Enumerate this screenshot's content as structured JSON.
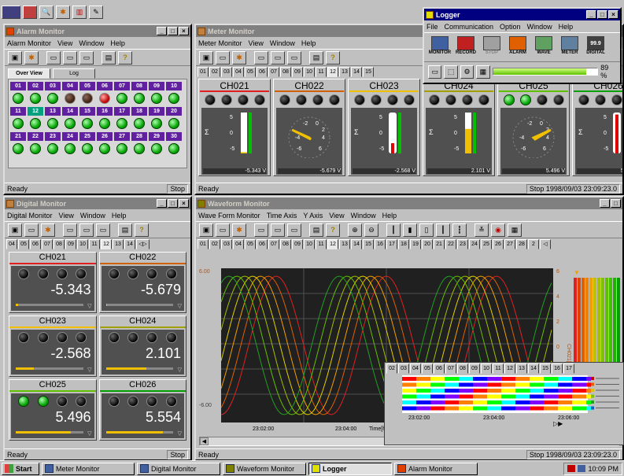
{
  "desktop_toolbar": {
    "icons": [
      "monitor-icon",
      "db-icon",
      "magnify-icon",
      "star-icon",
      "chart-icon",
      "pen-icon"
    ]
  },
  "alarm": {
    "title": "Alarm Monitor",
    "menu": [
      "Alarm Monitor",
      "View",
      "Window",
      "Help"
    ],
    "tabs": [
      "Over View",
      "Log"
    ],
    "rows": [
      {
        "ids": [
          "01",
          "02",
          "03",
          "04",
          "05",
          "06",
          "07",
          "08",
          "09",
          "10"
        ],
        "states": [
          "green",
          "green",
          "green",
          "dark",
          "dark",
          "red",
          "green",
          "green",
          "green",
          "green"
        ],
        "selected": ""
      },
      {
        "ids": [
          "11",
          "12",
          "13",
          "14",
          "15",
          "16",
          "17",
          "18",
          "19",
          "20"
        ],
        "states": [
          "green",
          "green",
          "green",
          "green",
          "green",
          "green",
          "green",
          "green",
          "green",
          "green"
        ],
        "selected": "12"
      },
      {
        "ids": [
          "21",
          "22",
          "23",
          "24",
          "25",
          "26",
          "27",
          "28",
          "29",
          "30"
        ],
        "states": [
          "green",
          "green",
          "green",
          "green",
          "green",
          "green",
          "green",
          "green",
          "green",
          "green"
        ],
        "selected": ""
      }
    ],
    "status_left": "Ready",
    "status_right": "Stop"
  },
  "meter": {
    "title": "Meter Monitor",
    "menu": [
      "Meter Monitor",
      "View",
      "Window",
      "Help"
    ],
    "tabs": [
      "01",
      "02",
      "03",
      "04",
      "05",
      "06",
      "07",
      "08",
      "09",
      "10",
      "11",
      "12",
      "13",
      "14",
      "15"
    ],
    "channels": [
      {
        "name": "CH021",
        "kind": "bar",
        "value": "-5.343 V",
        "level": 0.03,
        "bar_color": "#f0c000",
        "lamps": [
          "off",
          "off",
          "off",
          "off"
        ],
        "line_color": "#e02020"
      },
      {
        "name": "CH022",
        "kind": "gauge",
        "value": "-5.679 V",
        "level": 0.22,
        "lamps": [
          "off",
          "off",
          "off",
          "off"
        ],
        "line_color": "#d06000"
      },
      {
        "name": "CH023",
        "kind": "thermo",
        "value": "-2.568 V",
        "level": 0.25,
        "lamps": [
          "off",
          "off",
          "off",
          "off"
        ],
        "line_color": "#f0c000"
      },
      {
        "name": "CH024",
        "kind": "bar",
        "value": "2.101 V",
        "level": 0.6,
        "bar_color": "#f0c000",
        "lamps": [
          "off",
          "off",
          "off",
          "off"
        ],
        "line_color": "#a0a000"
      },
      {
        "name": "CH025",
        "kind": "gauge",
        "value": "5.496 V",
        "level": 0.78,
        "lamps": [
          "green",
          "green",
          "off",
          "off"
        ],
        "line_color": "#60c000"
      },
      {
        "name": "CH026",
        "kind": "thermo",
        "value": "5.554 V",
        "level": 0.95,
        "lamps": [
          "off",
          "off",
          "off",
          "off"
        ],
        "line_color": "#00a000"
      }
    ],
    "scale": [
      "5",
      "0",
      "-5"
    ],
    "gauge_scale": [
      "-2",
      "0",
      "2",
      "-4",
      "4",
      "-6",
      "6"
    ],
    "status_left": "Ready",
    "status_right": "Stop 1998/09/03 23:09:23.0"
  },
  "logger": {
    "title": "Logger",
    "menu": [
      "File",
      "Communication",
      "Option",
      "Window",
      "Help"
    ],
    "buttons": [
      {
        "label": "MONITOR",
        "icon": "monitor-icon"
      },
      {
        "label": "RECORD",
        "icon": "record-icon"
      },
      {
        "label": "STOP",
        "icon": "stop-icon"
      },
      {
        "label": "ALARM",
        "icon": "alarm-icon"
      },
      {
        "label": "WAVE",
        "icon": "wave-icon"
      },
      {
        "label": "METER",
        "icon": "meter-icon"
      },
      {
        "label": "DIGITAL",
        "icon": "digital-icon",
        "text": "99.9"
      }
    ],
    "progress_pct": "89 %",
    "progress": 0.89
  },
  "digital": {
    "title": "Digital Monitor",
    "menu": [
      "Digital Monitor",
      "View",
      "Window",
      "Help"
    ],
    "tabs": [
      "04",
      "05",
      "06",
      "07",
      "08",
      "09",
      "10",
      "11",
      "12",
      "13",
      "14"
    ],
    "channels": [
      {
        "name": "CH021",
        "value": "-5.343",
        "level": 0.03,
        "lamps": [
          "off",
          "off",
          "off",
          "off"
        ],
        "line_color": "#e02020"
      },
      {
        "name": "CH022",
        "value": "-5.679",
        "level": 0.02,
        "lamps": [
          "off",
          "off",
          "off",
          "off"
        ],
        "line_color": "#d06000"
      },
      {
        "name": "CH023",
        "value": "-2.568",
        "level": 0.27,
        "lamps": [
          "off",
          "off",
          "off",
          "off"
        ],
        "line_color": "#f0c000"
      },
      {
        "name": "CH024",
        "value": "2.101",
        "level": 0.6,
        "lamps": [
          "off",
          "off",
          "off",
          "off"
        ],
        "line_color": "#a0a000"
      },
      {
        "name": "CH025",
        "value": "5.496",
        "level": 0.82,
        "lamps": [
          "green",
          "green",
          "off",
          "off"
        ],
        "line_color": "#60c000"
      },
      {
        "name": "CH026",
        "value": "5.554",
        "level": 0.85,
        "lamps": [
          "off",
          "off",
          "off",
          "off"
        ],
        "line_color": "#00a000"
      }
    ],
    "status_left": "Ready",
    "status_right": "Stop"
  },
  "wave": {
    "title": "Waveform Monitor",
    "menu": [
      "Wave Form Monitor",
      "Time Axis",
      "Y Axis",
      "View",
      "Window",
      "Help"
    ],
    "tabs": [
      "01",
      "02",
      "03",
      "04",
      "05",
      "06",
      "07",
      "08",
      "09",
      "10",
      "11",
      "12",
      "13",
      "14",
      "15",
      "16",
      "17",
      "18",
      "19",
      "20",
      "21",
      "22",
      "23",
      "24",
      "25",
      "26",
      "27",
      "28",
      "2"
    ],
    "y_top": "6.00",
    "y_bottom": "-6.00",
    "right_scale": [
      "6",
      "4",
      "2",
      "0",
      "-2",
      "-4",
      "-6"
    ],
    "right_label": "CH021[V]",
    "x_labels": [
      "23:02:00",
      "23:04:00"
    ],
    "x_axis_label": "Time[h",
    "overlay_tabs": [
      "02",
      "03",
      "04",
      "05",
      "06",
      "07",
      "08",
      "09",
      "10",
      "11",
      "12",
      "13",
      "14",
      "15",
      "16",
      "17"
    ],
    "overlay_x": [
      "23:02:00",
      "23:04:00",
      "23:06:00"
    ],
    "status_left": "Ready",
    "status_right": "Stop 1998/09/03 23:09:23.0"
  },
  "taskbar": {
    "start": "Start",
    "items": [
      "Meter Monitor",
      "Digital Monitor",
      "Waveform Monitor",
      "Logger",
      "Alarm Monitor"
    ],
    "active": "Logger",
    "clock": "10:09 PM"
  },
  "colors": {
    "title_active": "#000080",
    "title_inactive": "#808080",
    "lamp_green": "#00a000"
  }
}
